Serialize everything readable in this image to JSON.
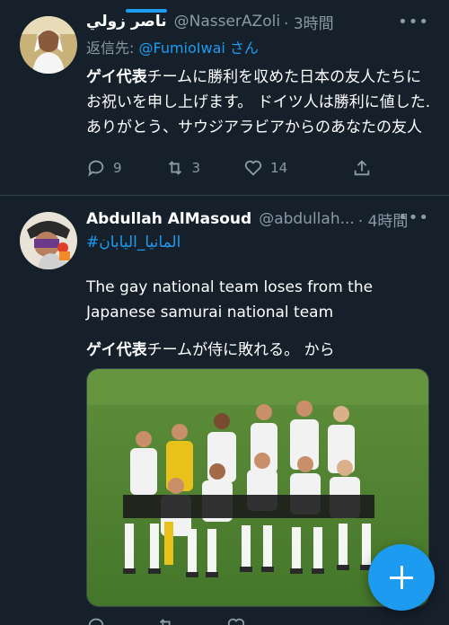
{
  "colors": {
    "background": "#15202b",
    "accent": "#1d9bf0",
    "secondary_text": "#8b98a5",
    "divider": "#38444d"
  },
  "tweets": [
    {
      "display_name": "ناصر زولي",
      "handle": "@NasserAZoli",
      "time": "· 3時間",
      "reply_prefix": "返信先: ",
      "reply_handle": "@FumioIwai",
      "reply_suffix": " さん",
      "text_bold": "ゲイ代表",
      "text_rest": "チームに勝利を収めた日本の友人たちにお祝いを申し上げます。 ドイツ人は勝利に値した.ありがとう、サウジアラビアからのあなたの友人",
      "replies": "9",
      "retweets": "3",
      "likes": "14",
      "more_icon": "more-dots-icon"
    },
    {
      "display_name": "Abdullah AlMasoud",
      "handle": "@abdullah...",
      "time": "· 4時間",
      "hashtag": "#المانيا_اليابان",
      "text_line1": "The gay national team loses from the Japanese samurai national team",
      "translation_bold": "ゲイ代表",
      "translation_rest": "チームが侍に敗れる。 から",
      "photo_description_icon": "team-photo",
      "more_icon": "more-dots-icon"
    }
  ],
  "fab": {
    "icon": "plus-icon"
  }
}
